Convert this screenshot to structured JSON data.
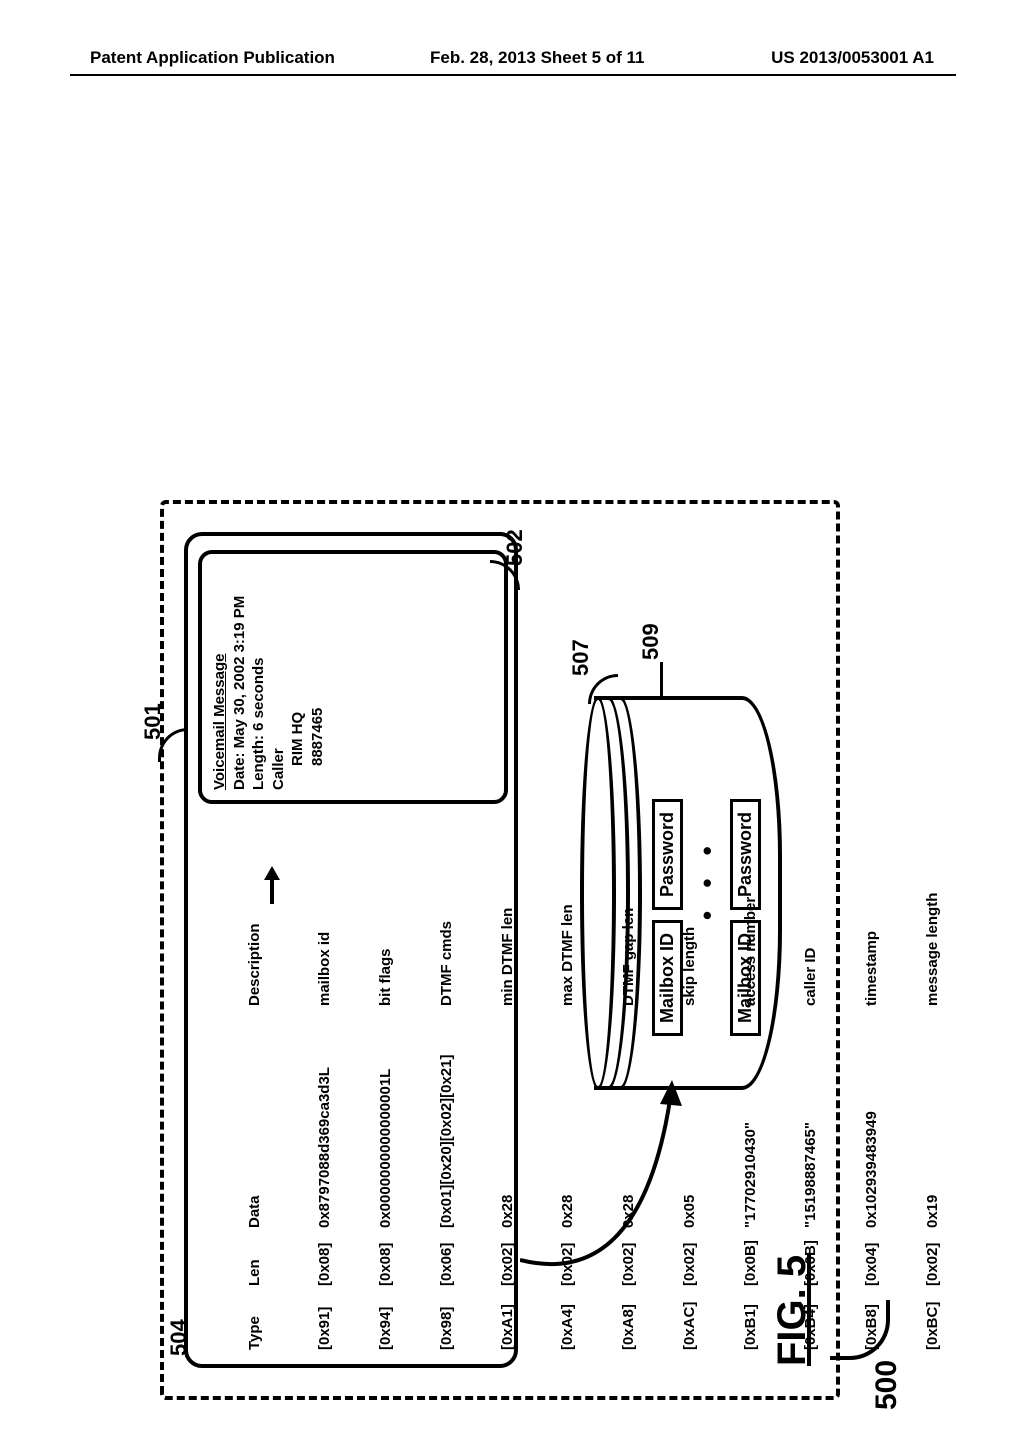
{
  "header": {
    "left": "Patent Application Publication",
    "center": "Feb. 28, 2013  Sheet 5 of 11",
    "right": "US 2013/0053001 A1"
  },
  "refs": {
    "r500": "500",
    "r501": "501",
    "r502": "502",
    "r504": "504",
    "r507": "507",
    "r509": "509"
  },
  "figure_label": "FIG. 5",
  "table": {
    "headers": {
      "type": "Type",
      "len": "Len",
      "data": "Data",
      "desc": "Description"
    },
    "rows": [
      {
        "type": "[0x91]",
        "len": "[0x08]",
        "data": "0x8797088d369ca3d3L",
        "desc": "mailbox id"
      },
      {
        "type": "[0x94]",
        "len": "[0x08]",
        "data": "0x0000000000000001L",
        "desc": "bit flags"
      },
      {
        "type": "[0x98]",
        "len": "[0x06]",
        "data": "[0x01][0x20][0x02][0x21]",
        "desc": "DTMF cmds"
      },
      {
        "type": "[0xA1]",
        "len": "[0x02]",
        "data": "0x28",
        "desc": "min DTMF len"
      },
      {
        "type": "[0xA4]",
        "len": "[0x02]",
        "data": "0x28",
        "desc": "max DTMF len"
      },
      {
        "type": "[0xA8]",
        "len": "[0x02]",
        "data": "0x28",
        "desc": "DTMF gap len"
      },
      {
        "type": "[0xAC]",
        "len": "[0x02]",
        "data": "0x05",
        "desc": "skip length"
      },
      {
        "type": "[0xB1]",
        "len": "[0x0B]",
        "data": "\"17702910430\"",
        "desc": "access number"
      },
      {
        "type": "[0xB4]",
        "len": "[0x0B]",
        "data": "\"15198887465\"",
        "desc": "caller ID"
      },
      {
        "type": "[0xB8]",
        "len": "[0x04]",
        "data": "0x102939483949",
        "desc": "timestamp"
      },
      {
        "type": "[0xBC]",
        "len": "[0x02]",
        "data": "0x19",
        "desc": "message length"
      }
    ]
  },
  "message": {
    "title": "Voicemail Message",
    "date_line": "Date: May 30, 2002  3:19 PM",
    "length_line": "Length: 6 seconds",
    "caller_label": "Caller",
    "caller_name": "RIM HQ",
    "caller_number": "8887465"
  },
  "db": {
    "row1_mailbox": "Mailbox ID",
    "row1_password": "Password",
    "row2_mailbox": "Mailbox ID",
    "row2_password": "Password",
    "dots": "• • •"
  }
}
